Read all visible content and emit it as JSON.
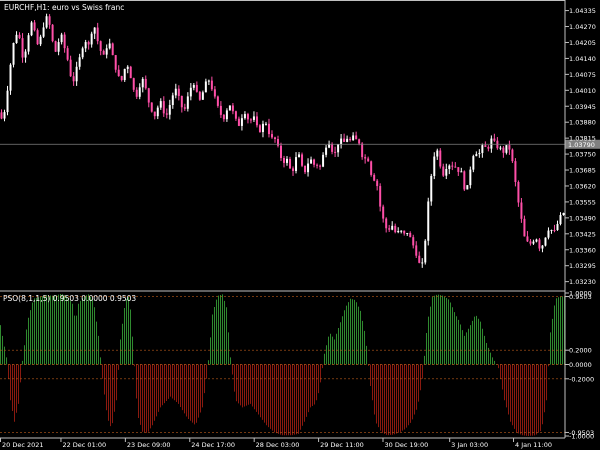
{
  "window": {
    "title": "EURCHF,H1:  euro vs Swiss franc"
  },
  "indicator": {
    "label": "PSO(8,1,1,5) 0.9503 0.0000 0.9503"
  },
  "colors": {
    "background": "#000000",
    "axis": "#c0c0c0",
    "text": "#ffffff",
    "candle_bull": "#ffffff",
    "candle_bear": "#ff4fa8",
    "hist_pos": "#2f8a2f",
    "hist_neg": "#8a1a10",
    "level_line": "#b85a1a",
    "price_line": "#808080",
    "price_tag_bg": "#808080"
  },
  "chart_data": [
    {
      "type": "candlestick",
      "name": "EURCHF,H1",
      "y_ticks": [
        "1.04335",
        "1.04270",
        "1.04205",
        "1.04140",
        "1.04075",
        "1.04010",
        "1.03945",
        "1.03880",
        "1.03815",
        "1.03750",
        "1.03685",
        "1.03620",
        "1.03555",
        "1.03490",
        "1.03425",
        "1.03360",
        "1.03295",
        "1.03230"
      ],
      "ylim": [
        1.032,
        1.0437
      ],
      "current_price": 1.0379,
      "current_price_label": "1.03790",
      "close_path": [
        [
          0,
          1.0392
        ],
        [
          3,
          1.0387
        ],
        [
          6,
          1.0398
        ],
        [
          9,
          1.0405
        ],
        [
          12,
          1.0418
        ],
        [
          15,
          1.0422
        ],
        [
          18,
          1.0426
        ],
        [
          20,
          1.0421
        ],
        [
          23,
          1.0414
        ],
        [
          26,
          1.0418
        ],
        [
          29,
          1.0425
        ],
        [
          32,
          1.0429
        ],
        [
          35,
          1.0424
        ],
        [
          38,
          1.0419
        ],
        [
          41,
          1.0423
        ],
        [
          44,
          1.0428
        ],
        [
          47,
          1.0431
        ],
        [
          50,
          1.0427
        ],
        [
          52,
          1.0422
        ],
        [
          55,
          1.0416
        ],
        [
          58,
          1.042
        ],
        [
          61,
          1.0424
        ],
        [
          64,
          1.0419
        ],
        [
          67,
          1.0415
        ],
        [
          70,
          1.0408
        ],
        [
          73,
          1.0404
        ],
        [
          76,
          1.0409
        ],
        [
          79,
          1.0413
        ],
        [
          82,
          1.0418
        ],
        [
          85,
          1.0422
        ],
        [
          88,
          1.0418
        ],
        [
          91,
          1.0424
        ],
        [
          94,
          1.0428
        ],
        [
          97,
          1.0422
        ],
        [
          100,
          1.0418
        ],
        [
          103,
          1.0414
        ],
        [
          106,
          1.0418
        ],
        [
          109,
          1.0421
        ],
        [
          112,
          1.0416
        ],
        [
          115,
          1.0411
        ],
        [
          118,
          1.0407
        ],
        [
          121,
          1.0404
        ],
        [
          124,
          1.0409
        ],
        [
          127,
          1.0412
        ],
        [
          130,
          1.0408
        ],
        [
          133,
          1.0402
        ],
        [
          136,
          1.0398
        ],
        [
          139,
          1.0402
        ],
        [
          142,
          1.0406
        ],
        [
          145,
          1.0403
        ],
        [
          148,
          1.0397
        ],
        [
          151,
          1.0394
        ],
        [
          154,
          1.039
        ],
        [
          157,
          1.0393
        ],
        [
          160,
          1.0397
        ],
        [
          163,
          1.0393
        ],
        [
          166,
          1.039
        ],
        [
          169,
          1.0394
        ],
        [
          172,
          1.0398
        ],
        [
          175,
          1.0402
        ],
        [
          178,
          1.0399
        ],
        [
          181,
          1.0395
        ],
        [
          184,
          1.0392
        ],
        [
          187,
          1.0397
        ],
        [
          190,
          1.0401
        ],
        [
          193,
          1.0405
        ],
        [
          196,
          1.0401
        ],
        [
          199,
          1.0396
        ],
        [
          202,
          1.0399
        ],
        [
          205,
          1.0403
        ],
        [
          208,
          1.0406
        ],
        [
          211,
          1.0403
        ],
        [
          214,
          1.0399
        ],
        [
          217,
          1.0395
        ],
        [
          220,
          1.0392
        ],
        [
          223,
          1.0389
        ],
        [
          226,
          1.0392
        ],
        [
          229,
          1.0396
        ],
        [
          232,
          1.0393
        ],
        [
          235,
          1.039
        ],
        [
          238,
          1.0386
        ],
        [
          241,
          1.0389
        ],
        [
          244,
          1.0393
        ],
        [
          247,
          1.039
        ],
        [
          250,
          1.0388
        ],
        [
          253,
          1.0391
        ],
        [
          256,
          1.0387
        ],
        [
          259,
          1.0384
        ],
        [
          262,
          1.0386
        ],
        [
          265,
          1.0389
        ],
        [
          268,
          1.0385
        ],
        [
          271,
          1.0381
        ],
        [
          274,
          1.0382
        ],
        [
          277,
          1.0379
        ],
        [
          280,
          1.0375
        ],
        [
          283,
          1.0371
        ],
        [
          286,
          1.0374
        ],
        [
          289,
          1.037
        ],
        [
          292,
          1.0367
        ],
        [
          295,
          1.0372
        ],
        [
          298,
          1.0376
        ],
        [
          301,
          1.0371
        ],
        [
          304,
          1.0367
        ],
        [
          307,
          1.037
        ],
        [
          310,
          1.0374
        ],
        [
          313,
          1.037
        ],
        [
          316,
          1.0372
        ],
        [
          319,
          1.0368
        ],
        [
          322,
          1.0373
        ],
        [
          325,
          1.0377
        ],
        [
          328,
          1.0381
        ],
        [
          331,
          1.0378
        ],
        [
          334,
          1.0374
        ],
        [
          337,
          1.0378
        ],
        [
          340,
          1.0382
        ],
        [
          343,
          1.0378
        ],
        [
          346,
          1.0383
        ],
        [
          349,
          1.0379
        ],
        [
          352,
          1.0383
        ],
        [
          355,
          1.038
        ],
        [
          358,
          1.0382
        ],
        [
          361,
          1.0376
        ],
        [
          364,
          1.0372
        ],
        [
          367,
          1.0375
        ],
        [
          370,
          1.0369
        ],
        [
          373,
          1.0364
        ],
        [
          376,
          1.0366
        ],
        [
          379,
          1.0356
        ],
        [
          382,
          1.035
        ],
        [
          385,
          1.0346
        ],
        [
          388,
          1.0343
        ],
        [
          391,
          1.0347
        ],
        [
          394,
          1.0344
        ],
        [
          397,
          1.0342
        ],
        [
          400,
          1.0345
        ],
        [
          403,
          1.0341
        ],
        [
          406,
          1.0344
        ],
        [
          409,
          1.0342
        ],
        [
          412,
          1.0339
        ],
        [
          415,
          1.0336
        ],
        [
          418,
          1.0332
        ],
        [
          421,
          1.0328
        ],
        [
          424,
          1.0333
        ],
        [
          427,
          1.035
        ],
        [
          430,
          1.0362
        ],
        [
          433,
          1.0372
        ],
        [
          436,
          1.0378
        ],
        [
          439,
          1.0374
        ],
        [
          442,
          1.0366
        ],
        [
          445,
          1.0368
        ],
        [
          448,
          1.0372
        ],
        [
          451,
          1.0369
        ],
        [
          454,
          1.0372
        ],
        [
          457,
          1.0367
        ],
        [
          460,
          1.037
        ],
        [
          463,
          1.0364
        ],
        [
          466,
          1.0358
        ],
        [
          469,
          1.0366
        ],
        [
          472,
          1.0373
        ],
        [
          475,
          1.0377
        ],
        [
          478,
          1.0374
        ],
        [
          481,
          1.0377
        ],
        [
          484,
          1.0379
        ],
        [
          487,
          1.0376
        ],
        [
          490,
          1.038
        ],
        [
          493,
          1.0382
        ],
        [
          496,
          1.0377
        ],
        [
          499,
          1.0379
        ],
        [
          502,
          1.0375
        ],
        [
          505,
          1.0377
        ],
        [
          508,
          1.0379
        ],
        [
          511,
          1.0375
        ],
        [
          514,
          1.0368
        ],
        [
          517,
          1.0358
        ],
        [
          520,
          1.0352
        ],
        [
          523,
          1.0344
        ],
        [
          526,
          1.0338
        ],
        [
          529,
          1.034
        ],
        [
          532,
          1.0337
        ],
        [
          535,
          1.0343
        ],
        [
          538,
          1.0338
        ],
        [
          541,
          1.0336
        ],
        [
          544,
          1.034
        ],
        [
          547,
          1.0343
        ],
        [
          550,
          1.0346
        ],
        [
          553,
          1.0342
        ],
        [
          556,
          1.0345
        ],
        [
          559,
          1.0348
        ],
        [
          562,
          1.0351
        ]
      ]
    },
    {
      "type": "bar",
      "name": "PSO(8,1,1,5)",
      "y_ticks": [
        "1.0000",
        "0.9503",
        "0.2000",
        "0.0000",
        "-0.2000",
        "-0.9503",
        "-1.0000"
      ],
      "levels": [
        0.9503,
        0.2,
        0,
        -0.2,
        -0.9503
      ],
      "ylim": [
        -1.0,
        1.0
      ],
      "profile": [
        [
          0,
          0.55
        ],
        [
          6,
          0.1
        ],
        [
          10,
          -0.5
        ],
        [
          14,
          -0.8
        ],
        [
          18,
          -0.55
        ],
        [
          22,
          0.05
        ],
        [
          27,
          0.6
        ],
        [
          33,
          0.92
        ],
        [
          40,
          0.95
        ],
        [
          47,
          0.97
        ],
        [
          54,
          0.96
        ],
        [
          61,
          0.99
        ],
        [
          67,
          0.95
        ],
        [
          72,
          0.85
        ],
        [
          75,
          0.6
        ],
        [
          78,
          0.85
        ],
        [
          83,
          0.95
        ],
        [
          88,
          0.98
        ],
        [
          93,
          0.9
        ],
        [
          98,
          0.4
        ],
        [
          102,
          -0.2
        ],
        [
          107,
          -0.75
        ],
        [
          111,
          -0.9
        ],
        [
          116,
          -0.5
        ],
        [
          120,
          0.35
        ],
        [
          125,
          0.9
        ],
        [
          129,
          0.96
        ],
        [
          133,
          0.2
        ],
        [
          137,
          -0.7
        ],
        [
          142,
          -0.94
        ],
        [
          147,
          -0.96
        ],
        [
          152,
          -0.85
        ],
        [
          160,
          -0.6
        ],
        [
          170,
          -0.45
        ],
        [
          178,
          -0.55
        ],
        [
          187,
          -0.75
        ],
        [
          195,
          -0.85
        ],
        [
          202,
          -0.6
        ],
        [
          207,
          -0.1
        ],
        [
          212,
          0.7
        ],
        [
          217,
          0.96
        ],
        [
          222,
          0.98
        ],
        [
          226,
          0.8
        ],
        [
          230,
          0.1
        ],
        [
          235,
          -0.5
        ],
        [
          242,
          -0.6
        ],
        [
          250,
          -0.55
        ],
        [
          258,
          -0.7
        ],
        [
          266,
          -0.85
        ],
        [
          274,
          -0.95
        ],
        [
          282,
          -0.99
        ],
        [
          291,
          -0.99
        ],
        [
          298,
          -0.97
        ],
        [
          304,
          -0.8
        ],
        [
          310,
          -0.6
        ],
        [
          315,
          -0.55
        ],
        [
          319,
          -0.35
        ],
        [
          324,
          0.15
        ],
        [
          329,
          0.45
        ],
        [
          334,
          0.35
        ],
        [
          339,
          0.55
        ],
        [
          345,
          0.8
        ],
        [
          350,
          0.92
        ],
        [
          355,
          0.9
        ],
        [
          360,
          0.75
        ],
        [
          365,
          0.4
        ],
        [
          370,
          -0.3
        ],
        [
          375,
          -0.8
        ],
        [
          381,
          -0.95
        ],
        [
          387,
          -0.99
        ],
        [
          393,
          -0.98
        ],
        [
          399,
          -0.95
        ],
        [
          405,
          -0.9
        ],
        [
          411,
          -0.8
        ],
        [
          417,
          -0.6
        ],
        [
          422,
          -0.2
        ],
        [
          427,
          0.6
        ],
        [
          432,
          0.95
        ],
        [
          437,
          0.98
        ],
        [
          443,
          0.96
        ],
        [
          449,
          0.9
        ],
        [
          455,
          0.7
        ],
        [
          459,
          0.6
        ],
        [
          464,
          0.4
        ],
        [
          470,
          0.55
        ],
        [
          475,
          0.7
        ],
        [
          480,
          0.6
        ],
        [
          486,
          0.3
        ],
        [
          492,
          0.1
        ],
        [
          498,
          -0.05
        ],
        [
          504,
          -0.5
        ],
        [
          510,
          -0.8
        ],
        [
          516,
          -0.95
        ],
        [
          522,
          -0.99
        ],
        [
          528,
          -1.0
        ],
        [
          535,
          -0.99
        ],
        [
          541,
          -0.92
        ],
        [
          546,
          -0.5
        ],
        [
          550,
          0.45
        ],
        [
          555,
          0.92
        ],
        [
          561,
          0.96
        ],
        [
          563,
          0.95
        ]
      ]
    }
  ],
  "x_axis": {
    "labels": [
      {
        "pos": 0.0,
        "text": "20 Dec 2021"
      },
      {
        "pos": 0.107,
        "text": "22 Dec 01:00"
      },
      {
        "pos": 0.221,
        "text": "23 Dec 09:00"
      },
      {
        "pos": 0.335,
        "text": "24 Dec 17:00"
      },
      {
        "pos": 0.449,
        "text": "28 Dec 03:00"
      },
      {
        "pos": 0.563,
        "text": "29 Dec 11:00"
      },
      {
        "pos": 0.677,
        "text": "30 Dec 19:00"
      },
      {
        "pos": 0.795,
        "text": "3 Jan 03:00"
      },
      {
        "pos": 0.908,
        "text": "4 Jan 11:00"
      }
    ]
  }
}
